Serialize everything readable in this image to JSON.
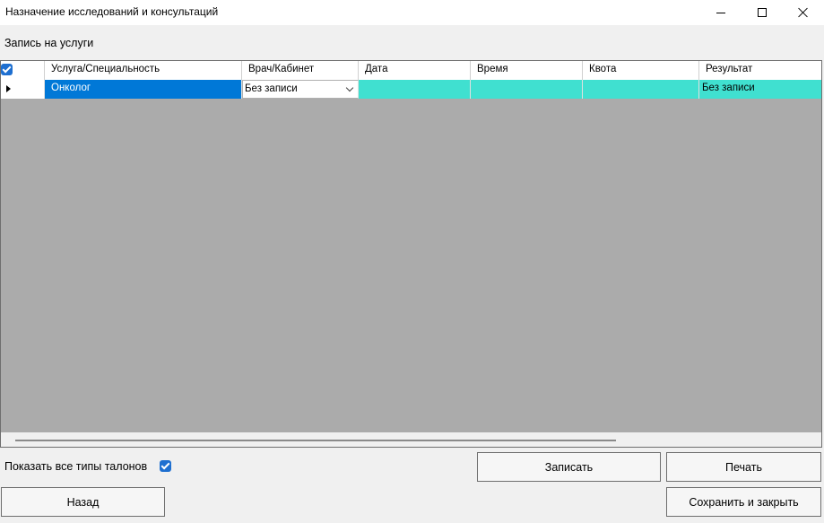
{
  "window": {
    "title": "Назначение исследований и консультаций"
  },
  "section_label": "Запись на услуги",
  "grid": {
    "columns": [
      "Услуга/Специальность",
      "Врач/Кабинет",
      "Дата",
      "Время",
      "Квота",
      "Результат"
    ],
    "rows": [
      {
        "service": "Онколог",
        "doctor": "Без записи",
        "date": "",
        "time": "",
        "quota": "",
        "result": "Без записи"
      }
    ],
    "header_checkbox_checked": true
  },
  "show_all_label": "Показать все типы талонов",
  "show_all_checked": true,
  "buttons": {
    "record": "Записать",
    "print": "Печать",
    "back": "Назад",
    "save_close": "Сохранить и закрыть"
  },
  "colors": {
    "selected_cell": "#0078d7",
    "highlight_row": "#40e0d0",
    "grid_background": "#ababab"
  }
}
